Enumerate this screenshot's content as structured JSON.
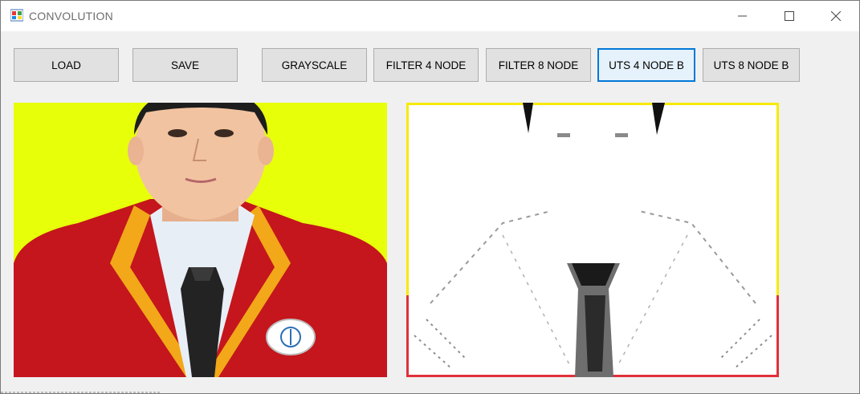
{
  "window": {
    "title": "CONVOLUTION",
    "app_icon": "windows-forms-icon",
    "controls": [
      {
        "name": "minimize",
        "icon": "minimize-icon"
      },
      {
        "name": "maximize",
        "icon": "maximize-icon"
      },
      {
        "name": "close",
        "icon": "close-icon"
      }
    ]
  },
  "toolbar": {
    "load": "LOAD",
    "save": "SAVE",
    "grayscale": "GRAYSCALE",
    "filter4": "FILTER 4 NODE",
    "filter8": "FILTER 8 NODE",
    "uts4": "UTS 4 NODE B",
    "uts8": "UTS 8 NODE B",
    "focused_button": "UTS 4 NODE B"
  },
  "images": {
    "original": {
      "type": "photo",
      "background_color": "#e8ff0a",
      "jacket_color": "#c4161c",
      "trim_color": "#f2a819"
    },
    "processed": {
      "type": "edge-detection-result",
      "background_color": "#ffffff",
      "border_top_color": "#f7ea00",
      "border_bottom_color": "#e0303a"
    }
  }
}
